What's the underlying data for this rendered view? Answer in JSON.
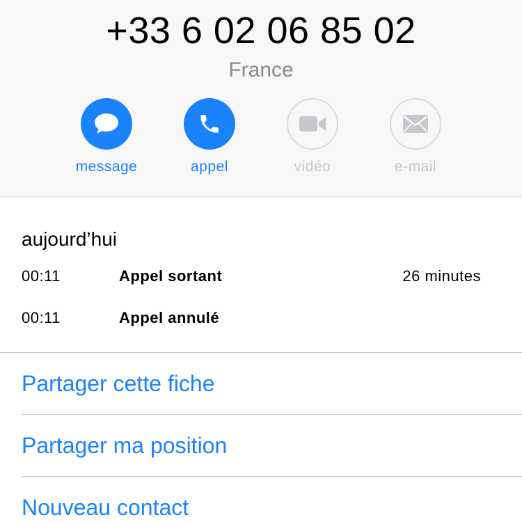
{
  "contact": {
    "phone_number": "+33 6 02 06 85 02",
    "country": "France"
  },
  "actions": [
    {
      "label": "message",
      "icon": "message-bubble-icon",
      "enabled": true
    },
    {
      "label": "appel",
      "icon": "phone-icon",
      "enabled": true
    },
    {
      "label": "vidéo",
      "icon": "video-camera-icon",
      "enabled": false
    },
    {
      "label": "e-mail",
      "icon": "envelope-icon",
      "enabled": false
    }
  ],
  "recents": {
    "date_label": "aujourd’hui",
    "calls": [
      {
        "time": "00:11",
        "type": "Appel sortant",
        "duration": "26 minutes"
      },
      {
        "time": "00:11",
        "type": "Appel annulé",
        "duration": ""
      }
    ]
  },
  "links": {
    "share_contact": "Partager cette fiche",
    "share_location": "Partager ma position",
    "new_contact": "Nouveau contact"
  },
  "colors": {
    "accent": "#1a82fb",
    "disabled": "#c7c7cc",
    "header_bg": "#f7f7f8"
  }
}
